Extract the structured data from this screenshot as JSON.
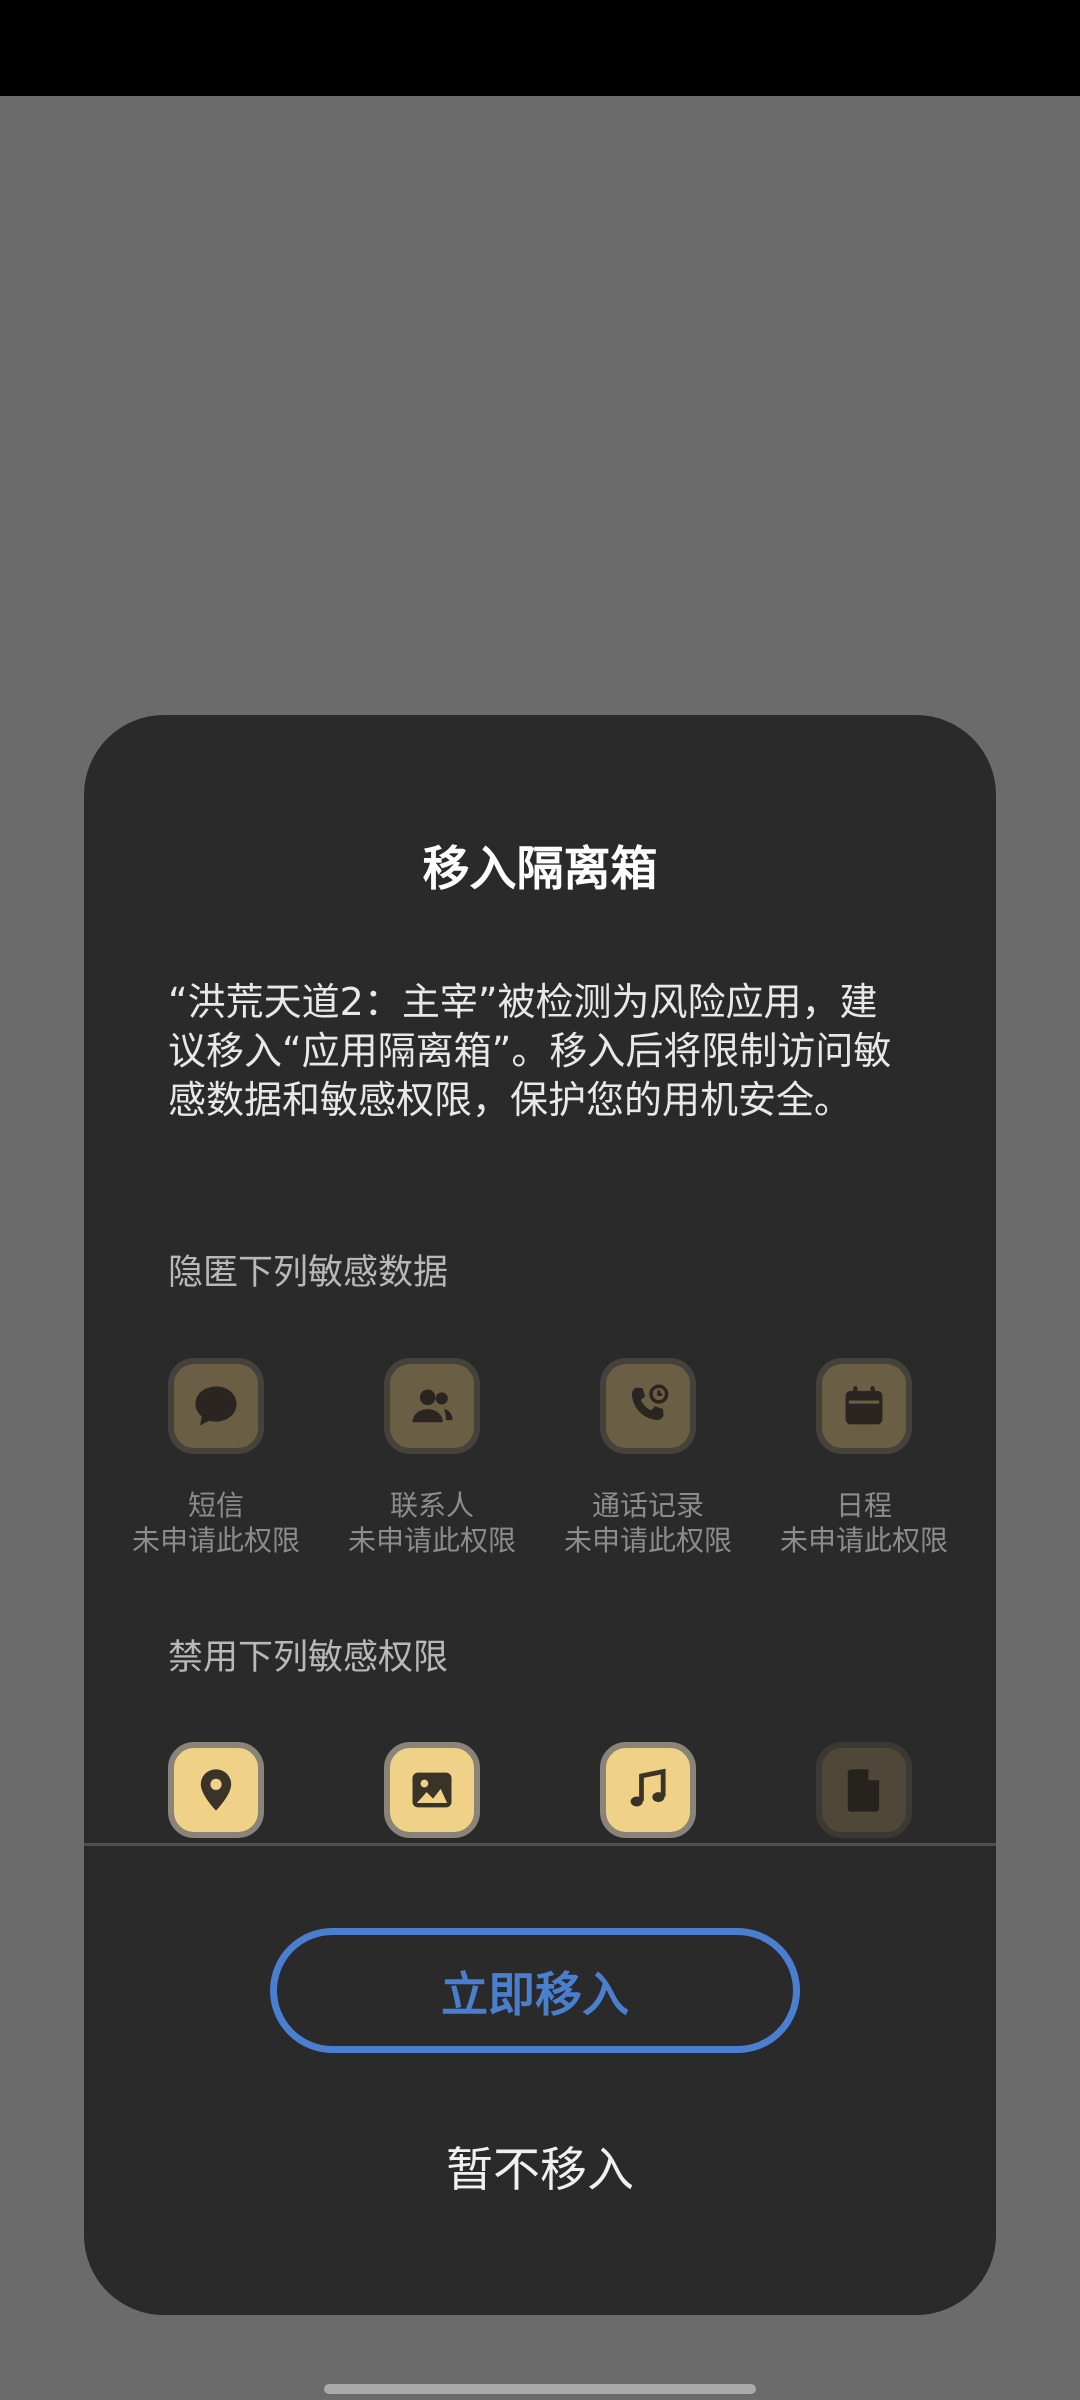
{
  "dialog": {
    "title": "移入隔离箱",
    "message": "“洪荒天道2：主宰”被检测为风险应用，建议移入“应用隔离箱”。移入后将限制访问敏感数据和敏感权限，保护您的用机安全。",
    "hidden_data_title": "隐匿下列敏感数据",
    "hidden_data_items": [
      {
        "name": "短信",
        "status": "未申请此权限",
        "icon": "message-icon"
      },
      {
        "name": "联系人",
        "status": "未申请此权限",
        "icon": "contacts-icon"
      },
      {
        "name": "通话记录",
        "status": "未申请此权限",
        "icon": "call-log-icon"
      },
      {
        "name": "日程",
        "status": "未申请此权限",
        "icon": "calendar-icon"
      }
    ],
    "disabled_permissions_title": "禁用下列敏感权限",
    "disabled_permissions_items": [
      {
        "icon": "location-icon"
      },
      {
        "icon": "image-icon"
      },
      {
        "icon": "music-icon"
      },
      {
        "icon": "file-icon"
      }
    ],
    "primary_button": "立即移入",
    "secondary_button": "暂不移入"
  },
  "colors": {
    "accent": "#4a7fd0",
    "icon_active": "#efd188",
    "icon_dim": "#6a5e44",
    "dialog_bg": "#2a2a2a"
  }
}
